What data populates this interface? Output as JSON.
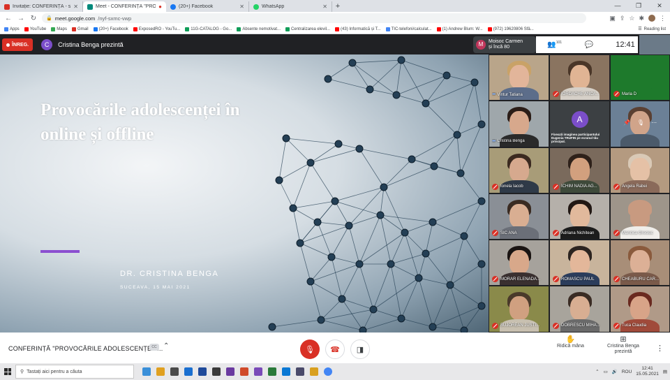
{
  "browser": {
    "tabs": [
      {
        "title": "Invitație: CONFERINȚĂ - sâm. 15 ...",
        "color": "#d93025",
        "active": false
      },
      {
        "title": "Meet - CONFERINȚĂ \"PROV...",
        "color": "#00897b",
        "active": true
      },
      {
        "title": "(20+) Facebook",
        "color": "#1877f2",
        "active": false
      },
      {
        "title": "WhatsApp",
        "color": "#25d366",
        "active": false
      }
    ],
    "new_tab": "+",
    "url_host": "meet.google.com",
    "url_path": "/nyf-sxmc-vwp",
    "bookmarks": [
      {
        "label": "Apps",
        "color": "#4285f4"
      },
      {
        "label": "YouTube",
        "color": "#ff0000"
      },
      {
        "label": "Maps",
        "color": "#34a853"
      },
      {
        "label": "Gmail",
        "color": "#d93025"
      },
      {
        "label": "(20+) Facebook",
        "color": "#1877f2"
      },
      {
        "label": "ExposedRO - YouTu...",
        "color": "#ff0000"
      },
      {
        "label": "11G-CATALOG - Go...",
        "color": "#0f9d58"
      },
      {
        "label": "Absente nemotivat...",
        "color": "#0f9d58"
      },
      {
        "label": "Centralizarea elevil...",
        "color": "#0f9d58"
      },
      {
        "label": "(43) Informatică și T...",
        "color": "#ff0000"
      },
      {
        "label": "TIC-telefoni/calculat...",
        "color": "#4285f4"
      },
      {
        "label": "(1) Andrew Blum: W...",
        "color": "#ff0000"
      },
      {
        "label": "(972) 19620806 Sfâ...",
        "color": "#ff0000"
      }
    ],
    "reading_list": "Reading list"
  },
  "meet": {
    "recording_label": "ÎNREG.",
    "presenter_initial": "C",
    "presenter_text": "Cristina Benga prezintă",
    "pinned_name_line1": "Moisoc Carmen",
    "pinned_name_line2": "și încă 80",
    "pinned_initial": "M",
    "participants_count": "101",
    "clock": "12:41",
    "slide": {
      "title": "Provocările adolescenței în online și offline",
      "author": "DR. CRISTINA BENGA",
      "date": "SUCEAVA, 15 MAI 2021"
    },
    "tiles": [
      {
        "name": "Vintur Tatiana",
        "muted": false,
        "bg": "#b9a58a",
        "skin": "#e2b59a",
        "hair": "#c9a267",
        "body": "#5c6d8a"
      },
      {
        "name": "IORDACHE ANCA...",
        "muted": true,
        "bg": "#8a7460",
        "skin": "#e0b494",
        "hair": "#4a3628",
        "body": "#d6d0c8"
      },
      {
        "name": "Maria D",
        "muted": true,
        "bg": "#1e7a2c",
        "skin": "#1e7a2c",
        "hair": "#1e7a2c",
        "body": "#1e7a2c"
      },
      {
        "name": "Cristina Benga",
        "muted": false,
        "bg": "#9fa7ab",
        "skin": "#d7a88c",
        "hair": "#2b1d17",
        "body": "#2a2a2a"
      },
      {
        "name": "avatar",
        "muted": false,
        "initial": "A",
        "caption": "Fixează imaginea participantului Eugenia TRUFIN pe ecranul tău principal."
      },
      {
        "name": "hover",
        "muted": false,
        "bg": "#6b8096",
        "skin": "#d0a48a",
        "hair": "#5a4032",
        "body": "#4b5a6a"
      },
      {
        "name": "Ionela Iacob",
        "muted": true,
        "bg": "#a89c78",
        "skin": "#d6a98e",
        "hair": "#3b2a20",
        "body": "#2f3a48"
      },
      {
        "name": "ICHIM NADIA AG...",
        "muted": true,
        "bg": "#7a6a5c",
        "skin": "#d2a07e",
        "hair": "#2e211a",
        "body": "#3e4a3a"
      },
      {
        "name": "Angela Rabei",
        "muted": true,
        "bg": "#b49a80",
        "skin": "#e5c1a6",
        "hair": "#d9c9b6",
        "body": "#8a6a5a"
      },
      {
        "name": "SIC ANA",
        "muted": true,
        "bg": "#8a8f96",
        "skin": "#d9ae92",
        "hair": "#3a2b22",
        "body": "#6b6f78"
      },
      {
        "name": "Adriana Nichitean",
        "muted": true,
        "bg": "#b5b0aa",
        "skin": "#e1b99c",
        "hair": "#221814",
        "body": "#1c1c1c"
      },
      {
        "name": "Maricica Greciuc",
        "muted": true,
        "bg": "#9e958a",
        "skin": "#c89a80",
        "hair": "#c89a80",
        "body": "#f0eeea"
      },
      {
        "name": "MORAR ELENADA...",
        "muted": true,
        "bg": "#a6a29c",
        "skin": "#d8a88a",
        "hair": "#1a1412",
        "body": "#3a3030"
      },
      {
        "name": "ROMASCU PAUL",
        "muted": true,
        "bg": "#c8b49c",
        "skin": "#e3b79a",
        "hair": "#2c2420",
        "body": "#2b3d5c"
      },
      {
        "name": "CHEABURU CAR...",
        "muted": true,
        "bg": "#a88e78",
        "skin": "#dcb096",
        "hair": "#8a5a3c",
        "body": "#7a5a4a"
      },
      {
        "name": "BUJOREAN JUSTI...",
        "muted": true,
        "bg": "#8a8a4a",
        "skin": "#d0a080",
        "hair": "#4a3a2a",
        "body": "#c8c0b0"
      },
      {
        "name": "DOBRESCU MIHA...",
        "muted": true,
        "bg": "#a8a49c",
        "skin": "#d8ae92",
        "hair": "#3a2c24",
        "body": "#6a6a6a"
      },
      {
        "name": "Tuca Claudia",
        "muted": true,
        "bg": "#b09a88",
        "skin": "#d8a488",
        "hair": "#6a2a20",
        "body": "#a04a3a"
      }
    ],
    "meeting_name": "CONFERINȚĂ \"PROVOCĂRILE ADOLESCENȚEI Î...",
    "cc_label": "CC",
    "raise_hand": "Ridică mâna",
    "presenting": "Cristina Benga prezintă"
  },
  "taskbar": {
    "search_placeholder": "Tastați aici pentru a căuta",
    "time": "12:41",
    "date": "15.05.2021",
    "language": "ROU",
    "apps": [
      "#3a8fd9",
      "#e0a020",
      "#4a4a4a",
      "#1a6fd0",
      "#1f4a9a",
      "#3a3a3a",
      "#6a3aa0",
      "#d04a2a",
      "#7a4ab8",
      "#2a7a3a",
      "#0a78d4",
      "#4a4a6a",
      "#d9a020",
      "#4285f4"
    ]
  }
}
